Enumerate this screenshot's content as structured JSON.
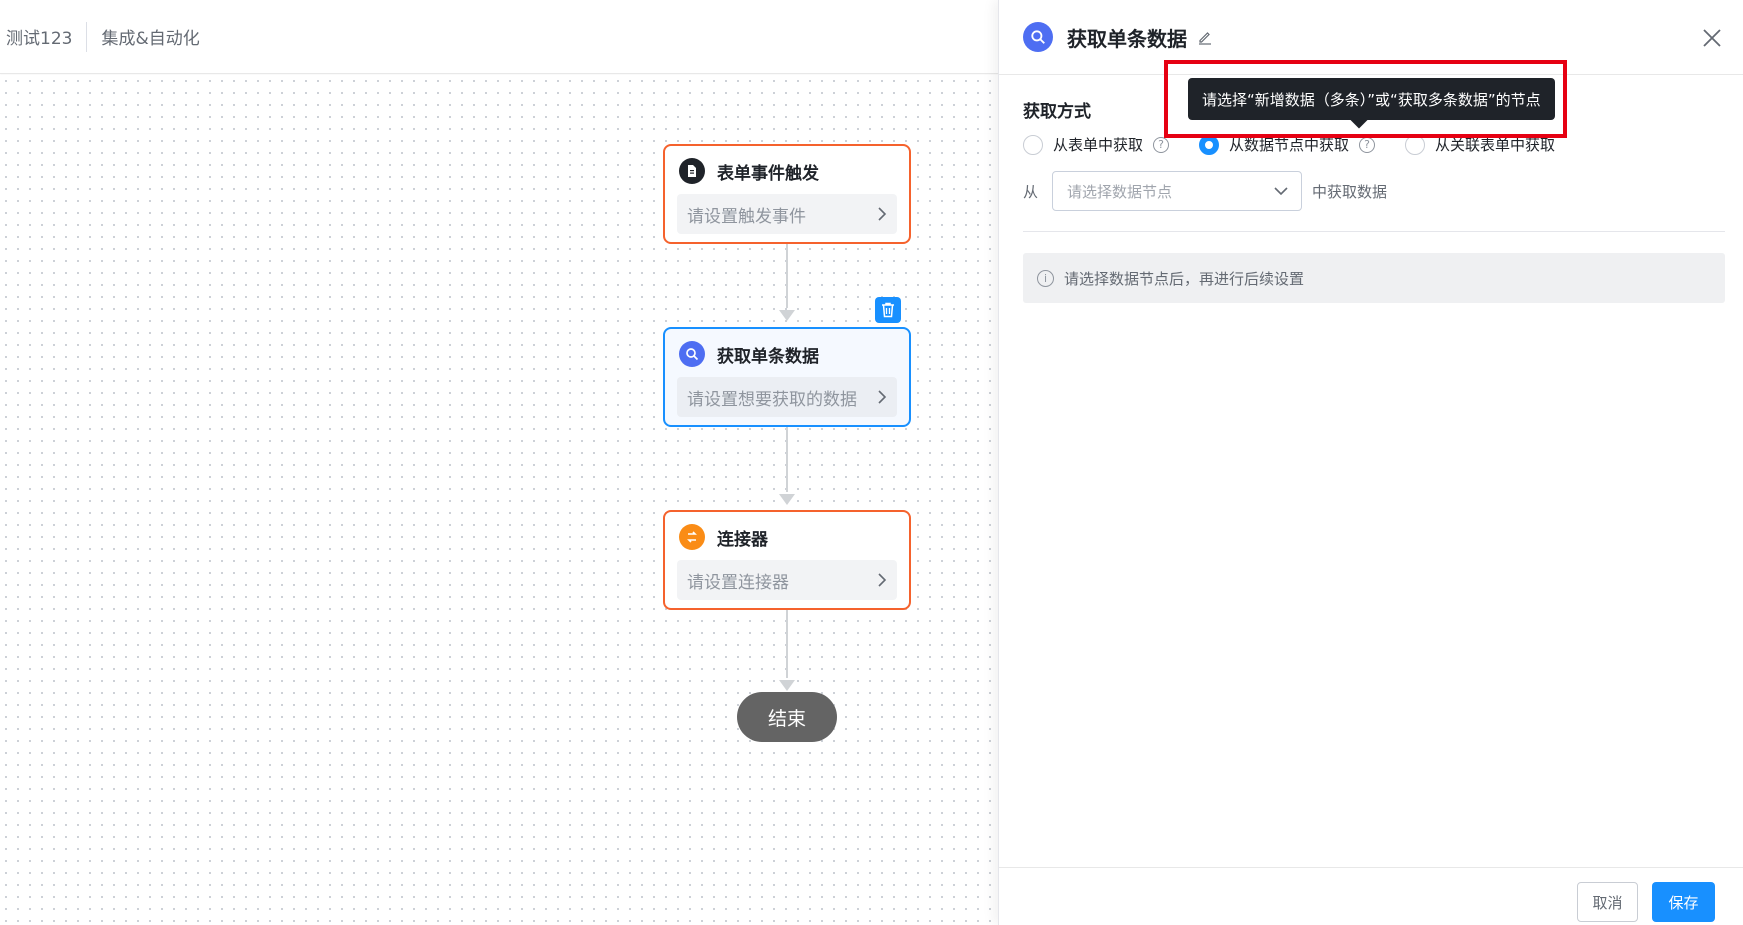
{
  "header": {
    "app_name": "测试123",
    "section": "集成&自动化"
  },
  "flow": {
    "nodes": [
      {
        "title": "表单事件触发",
        "placeholder": "请设置触发事件",
        "icon": "document-icon",
        "icon_color": "#1f2329",
        "border_color": "#f5622d"
      },
      {
        "title": "获取单条数据",
        "placeholder": "请设置想要获取的数据",
        "icon": "search-icon",
        "icon_color": "#4e6ef2",
        "border_color": "#1890ff"
      },
      {
        "title": "连接器",
        "placeholder": "请设置连接器",
        "icon": "connector-icon",
        "icon_color": "#fa8c16",
        "border_color": "#f5622d"
      }
    ],
    "end_label": "结束"
  },
  "panel": {
    "title": "获取单条数据",
    "section_label": "获取方式",
    "radio_options": [
      {
        "label": "从表单中获取",
        "selected": false,
        "has_help": true
      },
      {
        "label": "从数据节点中获取",
        "selected": true,
        "has_help": true
      },
      {
        "label": "从关联表单中获取",
        "selected": false,
        "has_help": false
      }
    ],
    "from_label": "从",
    "select_placeholder": "请选择数据节点",
    "from_suffix": "中获取数据",
    "info_text": "请选择数据节点后，再进行后续设置",
    "tooltip_text": "请选择“新增数据（多条）”或“获取多条数据”的节点",
    "cancel_label": "取消",
    "save_label": "保存"
  },
  "colors": {
    "accent": "#1890ff",
    "node_border": "#f5622d",
    "highlight": "#e60012"
  }
}
